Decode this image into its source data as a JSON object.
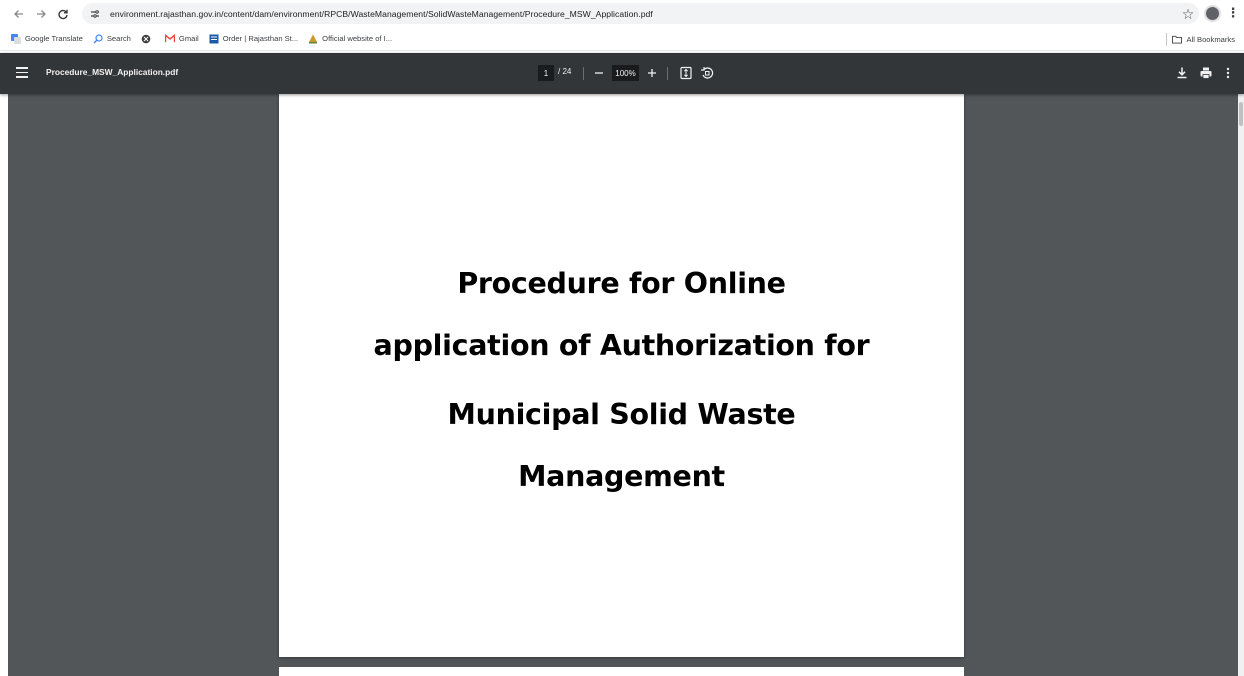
{
  "browser": {
    "url": "environment.rajasthan.gov.in/content/dam/environment/RPCB/WasteManagement/SolidWasteManagement/Procedure_MSW_Application.pdf",
    "nav_icons": [
      "back-arrow-icon",
      "forward-arrow-icon",
      "reload-icon",
      "site-info-icon",
      "star-icon",
      "profile-avatar",
      "kebab-menu-icon"
    ]
  },
  "bookmarks": {
    "items": [
      {
        "label": "Google Translate",
        "icon": "google-translate-icon"
      },
      {
        "label": "Search",
        "icon": "search-icon"
      },
      {
        "label": "",
        "icon": "globe-icon"
      },
      {
        "label": "Gmail",
        "icon": "gmail-icon"
      },
      {
        "label": "Order | Rajasthan St...",
        "icon": "document-icon"
      },
      {
        "label": "Official website of I...",
        "icon": "emblem-icon"
      }
    ],
    "all_bookmarks": "All Bookmarks"
  },
  "pdf_viewer": {
    "file_name": "Procedure_MSW_Application.pdf",
    "current_page": "1",
    "total_pages": "/ 24",
    "zoom": "100%",
    "colors": {
      "toolbar": "#333639",
      "background": "#525659",
      "page": "#ffffff"
    }
  },
  "document": {
    "title_lines": [
      "Procedure for Online",
      "application of Authorization for",
      "Municipal Solid Waste",
      "Management"
    ]
  }
}
